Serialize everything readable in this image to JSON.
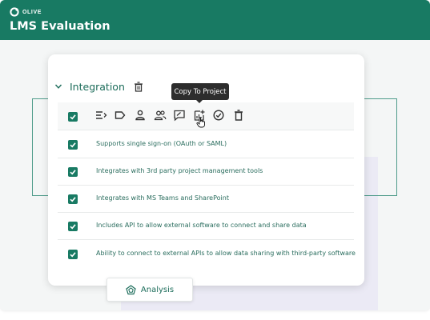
{
  "app": {
    "brand": "OLIVE",
    "title": "LMS Evaluation"
  },
  "section": {
    "title": "Integration"
  },
  "tooltip": {
    "text": "Copy To Project"
  },
  "toolbar": {
    "icons": [
      "list-icon",
      "tag-icon",
      "person-icon",
      "people-icon",
      "comment-icon",
      "copy-to-project-icon",
      "check-circle-icon",
      "trash-icon"
    ]
  },
  "requirements": [
    {
      "text": "Supports single sign-on (OAuth or SAML)",
      "checked": true
    },
    {
      "text": "Integrates with 3rd party project management tools",
      "checked": true
    },
    {
      "text": "Integrates with MS Teams and SharePoint",
      "checked": true
    },
    {
      "text": "Includes API to allow external software to connect and share data",
      "checked": true
    },
    {
      "text": "Ability to connect to external APIs to allow data sharing with third-party software",
      "checked": true
    }
  ],
  "tabs": {
    "analysis_label": "Analysis"
  },
  "colors": {
    "brand": "#187a63",
    "text_teal": "#2a6d5e",
    "tooltip_bg": "#2d2d2d"
  }
}
